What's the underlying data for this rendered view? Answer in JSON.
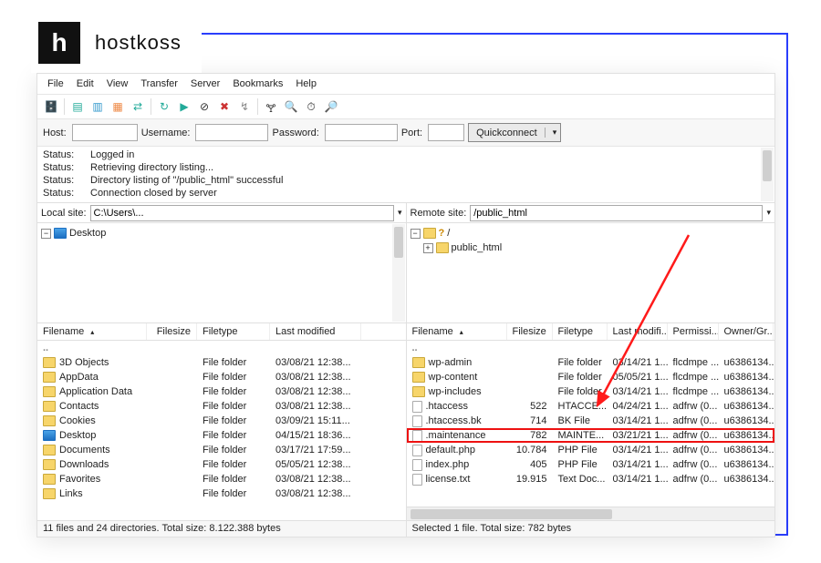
{
  "brand": {
    "mark": "h",
    "name": "hostkoss"
  },
  "menu": [
    "File",
    "Edit",
    "View",
    "Transfer",
    "Server",
    "Bookmarks",
    "Help"
  ],
  "conn": {
    "host_label": "Host:",
    "user_label": "Username:",
    "pass_label": "Password:",
    "port_label": "Port:",
    "quickconnect": "Quickconnect"
  },
  "log": [
    {
      "k": "Status:",
      "v": "Logged in"
    },
    {
      "k": "Status:",
      "v": "Retrieving directory listing..."
    },
    {
      "k": "Status:",
      "v": "Directory listing of \"/public_html\" successful"
    },
    {
      "k": "Status:",
      "v": "Connection closed by server"
    }
  ],
  "local": {
    "label": "Local site:",
    "path": "C:\\Users\\...",
    "tree": [
      {
        "name": "Desktop",
        "icon": "desktop",
        "exp": "-",
        "depth": 0
      }
    ],
    "cols": [
      "Filename",
      "Filesize",
      "Filetype",
      "Last modified"
    ],
    "rows": [
      {
        "n": "..",
        "ic": "up"
      },
      {
        "n": "3D Objects",
        "t": "File folder",
        "m": "03/08/21 12:38..."
      },
      {
        "n": "AppData",
        "t": "File folder",
        "m": "03/08/21 12:38..."
      },
      {
        "n": "Application Data",
        "t": "File folder",
        "m": "03/08/21 12:38..."
      },
      {
        "n": "Contacts",
        "t": "File folder",
        "m": "03/08/21 12:38..."
      },
      {
        "n": "Cookies",
        "t": "File folder",
        "m": "03/09/21 15:11..."
      },
      {
        "n": "Desktop",
        "ic": "desktop",
        "t": "File folder",
        "m": "04/15/21 18:36..."
      },
      {
        "n": "Documents",
        "t": "File folder",
        "m": "03/17/21 17:59..."
      },
      {
        "n": "Downloads",
        "t": "File folder",
        "m": "05/05/21 12:38..."
      },
      {
        "n": "Favorites",
        "t": "File folder",
        "m": "03/08/21 12:38..."
      },
      {
        "n": "Links",
        "t": "File folder",
        "m": "03/08/21 12:38..."
      }
    ],
    "status": "11 files and 24 directories. Total size: 8.122.388 bytes"
  },
  "remote": {
    "label": "Remote site:",
    "path": "/public_html",
    "tree": [
      {
        "name": "/",
        "icon": "q",
        "exp": "-",
        "depth": 0
      },
      {
        "name": "public_html",
        "icon": "folder",
        "exp": "+",
        "depth": 1
      }
    ],
    "cols": [
      "Filename",
      "Filesize",
      "Filetype",
      "Last modifi...",
      "Permissi...",
      "Owner/Gr..."
    ],
    "rows": [
      {
        "n": "..",
        "ic": "up"
      },
      {
        "n": "wp-admin",
        "ic": "folder",
        "t": "File folder",
        "m": "03/14/21 1...",
        "p": "flcdmpe ...",
        "o": "u6386134..."
      },
      {
        "n": "wp-content",
        "ic": "folder",
        "t": "File folder",
        "m": "05/05/21 1...",
        "p": "flcdmpe ...",
        "o": "u6386134..."
      },
      {
        "n": "wp-includes",
        "ic": "folder",
        "t": "File folder",
        "m": "03/14/21 1...",
        "p": "flcdmpe ...",
        "o": "u6386134..."
      },
      {
        "n": ".htaccess",
        "ic": "file",
        "s": "522",
        "t": "HTACCE...",
        "m": "04/24/21 1...",
        "p": "adfrw (0...",
        "o": "u6386134..."
      },
      {
        "n": ".htaccess.bk",
        "ic": "file",
        "s": "714",
        "t": "BK File",
        "m": "03/14/21 1...",
        "p": "adfrw (0...",
        "o": "u6386134..."
      },
      {
        "n": ".maintenance",
        "ic": "file",
        "s": "782",
        "t": "MAINTE...",
        "m": "03/21/21 1...",
        "p": "adfrw (0...",
        "o": "u6386134...",
        "sel": true
      },
      {
        "n": "default.php",
        "ic": "file",
        "s": "10.784",
        "t": "PHP File",
        "m": "03/14/21 1...",
        "p": "adfrw (0...",
        "o": "u6386134..."
      },
      {
        "n": "index.php",
        "ic": "file",
        "s": "405",
        "t": "PHP File",
        "m": "03/14/21 1...",
        "p": "adfrw (0...",
        "o": "u6386134..."
      },
      {
        "n": "license.txt",
        "ic": "file",
        "s": "19.915",
        "t": "Text Doc...",
        "m": "03/14/21 1...",
        "p": "adfrw (0...",
        "o": "u6386134..."
      }
    ],
    "status": "Selected 1 file. Total size: 782 bytes"
  }
}
